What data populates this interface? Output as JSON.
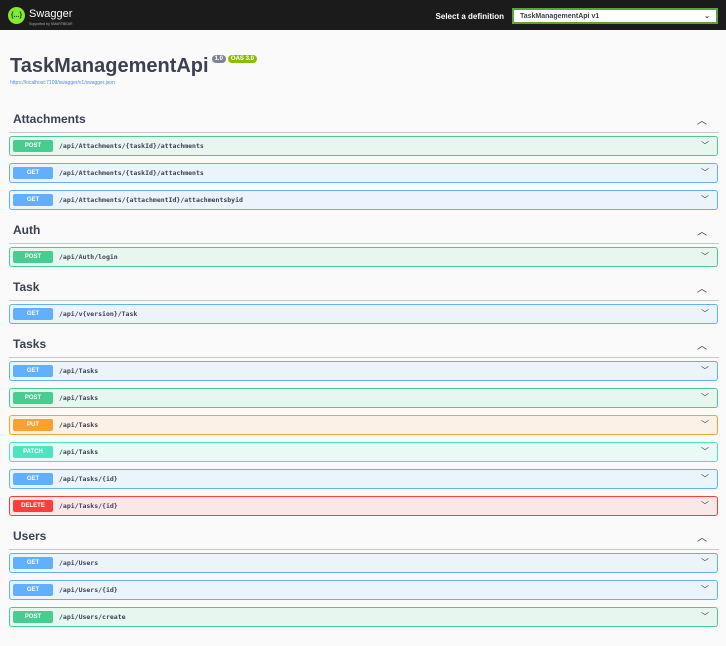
{
  "topbar": {
    "logo_text": "Swagger",
    "logo_sub": "Supported by SMARTBEAR",
    "logo_glyph": "{...}",
    "definition_label": "Select a definition",
    "definition_value": "TaskManagementApi v1"
  },
  "info": {
    "title": "TaskManagementApi",
    "version": "1.0",
    "oas": "OAS 3.0",
    "url": "https://localhost:7109/swagger/v1/swagger.json"
  },
  "sections": [
    {
      "name": "Attachments",
      "ops": [
        {
          "method": "POST",
          "path": "/api/Attachments/{taskId}/attachments"
        },
        {
          "method": "GET",
          "path": "/api/Attachments/{taskId}/attachments"
        },
        {
          "method": "GET",
          "path": "/api/Attachments/{attachmentId}/attachmentsbyid"
        }
      ]
    },
    {
      "name": "Auth",
      "ops": [
        {
          "method": "POST",
          "path": "/api/Auth/login"
        }
      ]
    },
    {
      "name": "Task",
      "ops": [
        {
          "method": "GET",
          "path": "/api/v{version}/Task"
        }
      ]
    },
    {
      "name": "Tasks",
      "ops": [
        {
          "method": "GET",
          "path": "/api/Tasks"
        },
        {
          "method": "POST",
          "path": "/api/Tasks"
        },
        {
          "method": "PUT",
          "path": "/api/Tasks"
        },
        {
          "method": "PATCH",
          "path": "/api/Tasks"
        },
        {
          "method": "GET",
          "path": "/api/Tasks/{id}"
        },
        {
          "method": "DELETE",
          "path": "/api/Tasks/{id}"
        }
      ]
    },
    {
      "name": "Users",
      "ops": [
        {
          "method": "GET",
          "path": "/api/Users"
        },
        {
          "method": "GET",
          "path": "/api/Users/{id}"
        },
        {
          "method": "POST",
          "path": "/api/Users/create"
        }
      ]
    }
  ]
}
